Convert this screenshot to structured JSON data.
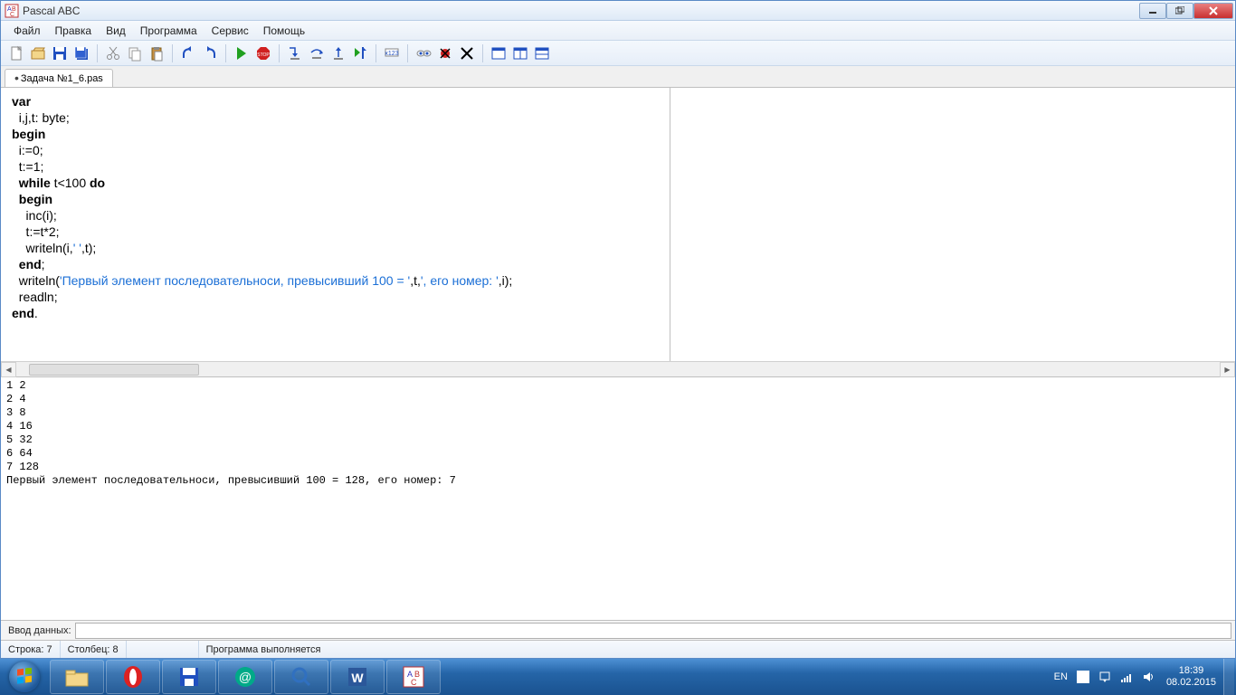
{
  "window": {
    "title": "Pascal ABC"
  },
  "menu": {
    "items": [
      "Файл",
      "Правка",
      "Вид",
      "Программа",
      "Сервис",
      "Помощь"
    ]
  },
  "tabs": {
    "active": "Задача №1_6.pas"
  },
  "code": {
    "tokens": [
      [
        {
          "t": "var",
          "k": true
        }
      ],
      [
        {
          "t": "  i,j,t: byte;"
        }
      ],
      [
        {
          "t": "begin",
          "k": true
        }
      ],
      [
        {
          "t": "  i:=0;"
        }
      ],
      [
        {
          "t": "  t:=1;"
        }
      ],
      [
        {
          "t": "  "
        },
        {
          "t": "while",
          "k": true
        },
        {
          "t": " t<100 "
        },
        {
          "t": "do",
          "k": true
        }
      ],
      [
        {
          "t": "  "
        },
        {
          "t": "begin",
          "k": true
        }
      ],
      [
        {
          "t": "    inc(i);"
        }
      ],
      [
        {
          "t": "    t:=t*2;"
        }
      ],
      [
        {
          "t": "    writeln(i,"
        },
        {
          "t": "' '",
          "s": true
        },
        {
          "t": ",t);"
        }
      ],
      [
        {
          "t": "  "
        },
        {
          "t": "end",
          "k": true
        },
        {
          "t": ";"
        }
      ],
      [
        {
          "t": "  writeln("
        },
        {
          "t": "'Первый элемент последовательноси, превысивший 100 = '",
          "s": true
        },
        {
          "t": ",t,"
        },
        {
          "t": "', его номер: '",
          "s": true
        },
        {
          "t": ",i);"
        }
      ],
      [
        {
          "t": "  readln;"
        }
      ],
      [
        {
          "t": "end",
          "k": true
        },
        {
          "t": "."
        }
      ]
    ]
  },
  "output": "1 2\n2 4\n3 8\n4 16\n5 32\n6 64\n7 128\nПервый элемент последовательноси, превысивший 100 = 128, его номер: 7",
  "input_area": {
    "label": "Ввод данных:"
  },
  "status": {
    "line": "Строка: 7",
    "col": "Столбец: 8",
    "msg": "Программа выполняется"
  },
  "tray": {
    "lang": "EN",
    "time": "18:39",
    "date": "08.02.2015"
  },
  "toolbar_icons": [
    "new",
    "open",
    "save",
    "save-all",
    "sep",
    "cut",
    "copy",
    "paste",
    "sep",
    "undo",
    "redo",
    "sep",
    "run",
    "stop",
    "sep",
    "step-into",
    "step-over",
    "step-out",
    "run-to-cursor",
    "sep",
    "eval",
    "sep",
    "watch",
    "breakpoint",
    "delete-bp",
    "sep",
    "win1",
    "win2",
    "win3"
  ]
}
